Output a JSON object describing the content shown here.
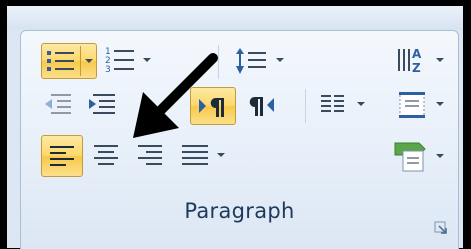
{
  "group": {
    "label": "Paragraph"
  },
  "buttons": {
    "bullets": {
      "icon": "bullets-icon",
      "state": "active"
    },
    "numbering": {
      "icon": "numbering-icon"
    },
    "multilevel_list": {
      "icon": "multilevel-list-icon"
    },
    "line_spacing": {
      "icon": "line-spacing-icon"
    },
    "sort": {
      "icon": "sort-icon"
    },
    "decrease_indent": {
      "icon": "decrease-indent-icon"
    },
    "increase_indent": {
      "icon": "increase-indent-icon"
    },
    "ltr": {
      "icon": "left-to-right-icon",
      "state": "active"
    },
    "rtl": {
      "icon": "right-to-left-icon"
    },
    "columns": {
      "icon": "columns-icon"
    },
    "borders": {
      "icon": "borders-icon"
    },
    "align_left": {
      "icon": "align-left-icon",
      "state": "active"
    },
    "center": {
      "icon": "align-center-icon"
    },
    "align_right": {
      "icon": "align-right-icon"
    },
    "justify": {
      "icon": "justify-icon"
    },
    "shading": {
      "icon": "shading-icon"
    },
    "dialog_launcher": {
      "icon": "dialog-launcher-icon"
    }
  },
  "annotation": {
    "icon": "arrow-pointer-icon"
  },
  "colors": {
    "active_fill": "#fbd96c",
    "panel_bg": "#e7eff9",
    "label_text": "#1e395b",
    "border_frame": "#000000"
  }
}
